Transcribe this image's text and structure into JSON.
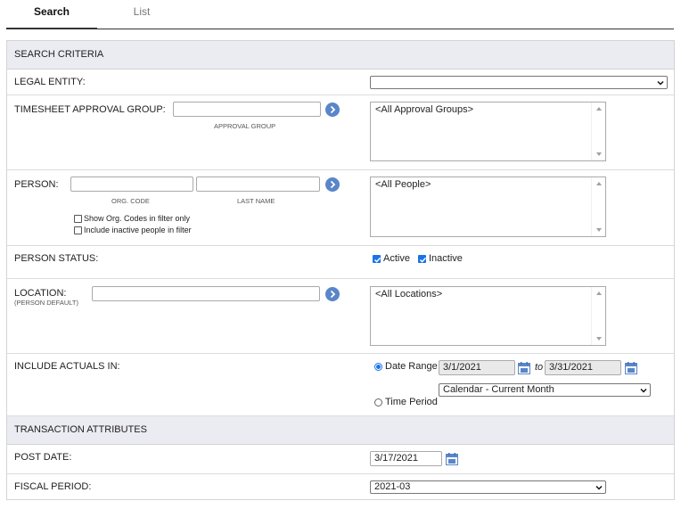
{
  "tabs": [
    {
      "label": "Search",
      "active": true
    },
    {
      "label": "List",
      "active": false
    }
  ],
  "search_criteria": {
    "header": "SEARCH CRITERIA",
    "legal_entity": {
      "label": "LEGAL ENTITY:",
      "value": ""
    },
    "approval_group": {
      "label": "TIMESHEET APPROVAL GROUP:",
      "input_value": "",
      "input_caption": "APPROVAL GROUP",
      "list_items": [
        "<All Approval Groups>"
      ]
    },
    "person": {
      "label": "PERSON:",
      "org_code_value": "",
      "org_code_caption": "ORG. CODE",
      "last_name_value": "",
      "last_name_caption": "LAST NAME",
      "show_org_codes_label": "Show Org. Codes in filter only",
      "show_org_codes_checked": false,
      "include_inactive_label": "Include inactive people in filter",
      "include_inactive_checked": false,
      "list_items": [
        "<All People>"
      ]
    },
    "person_status": {
      "label": "PERSON STATUS:",
      "active_label": "Active",
      "active_checked": true,
      "inactive_label": "Inactive",
      "inactive_checked": true
    },
    "location": {
      "label": "LOCATION:",
      "sublabel": "(PERSON DEFAULT)",
      "input_value": "",
      "list_items": [
        "<All Locations>"
      ]
    },
    "include_actuals": {
      "label": "INCLUDE ACTUALS IN:",
      "date_range_label": "Date Range",
      "date_range_selected": true,
      "from_date": "3/1/2021",
      "to_label": "to",
      "to_date": "3/31/2021",
      "range_preset": "Calendar - Current Month",
      "time_period_label": "Time Period",
      "time_period_selected": false
    }
  },
  "transaction_attributes": {
    "header": "TRANSACTION ATTRIBUTES",
    "post_date": {
      "label": "POST DATE:",
      "value": "3/17/2021"
    },
    "fiscal_period": {
      "label": "FISCAL PERIOD:",
      "value": "2021-03"
    }
  },
  "icons": {
    "go": "arrow-right-circle-icon",
    "calendar": "calendar-icon",
    "dropdown": "chevron-down-icon"
  },
  "colors": {
    "section_header_bg": "#ebebf2",
    "accent_blue": "#1a73e8",
    "go_button": "#5a86c9"
  }
}
